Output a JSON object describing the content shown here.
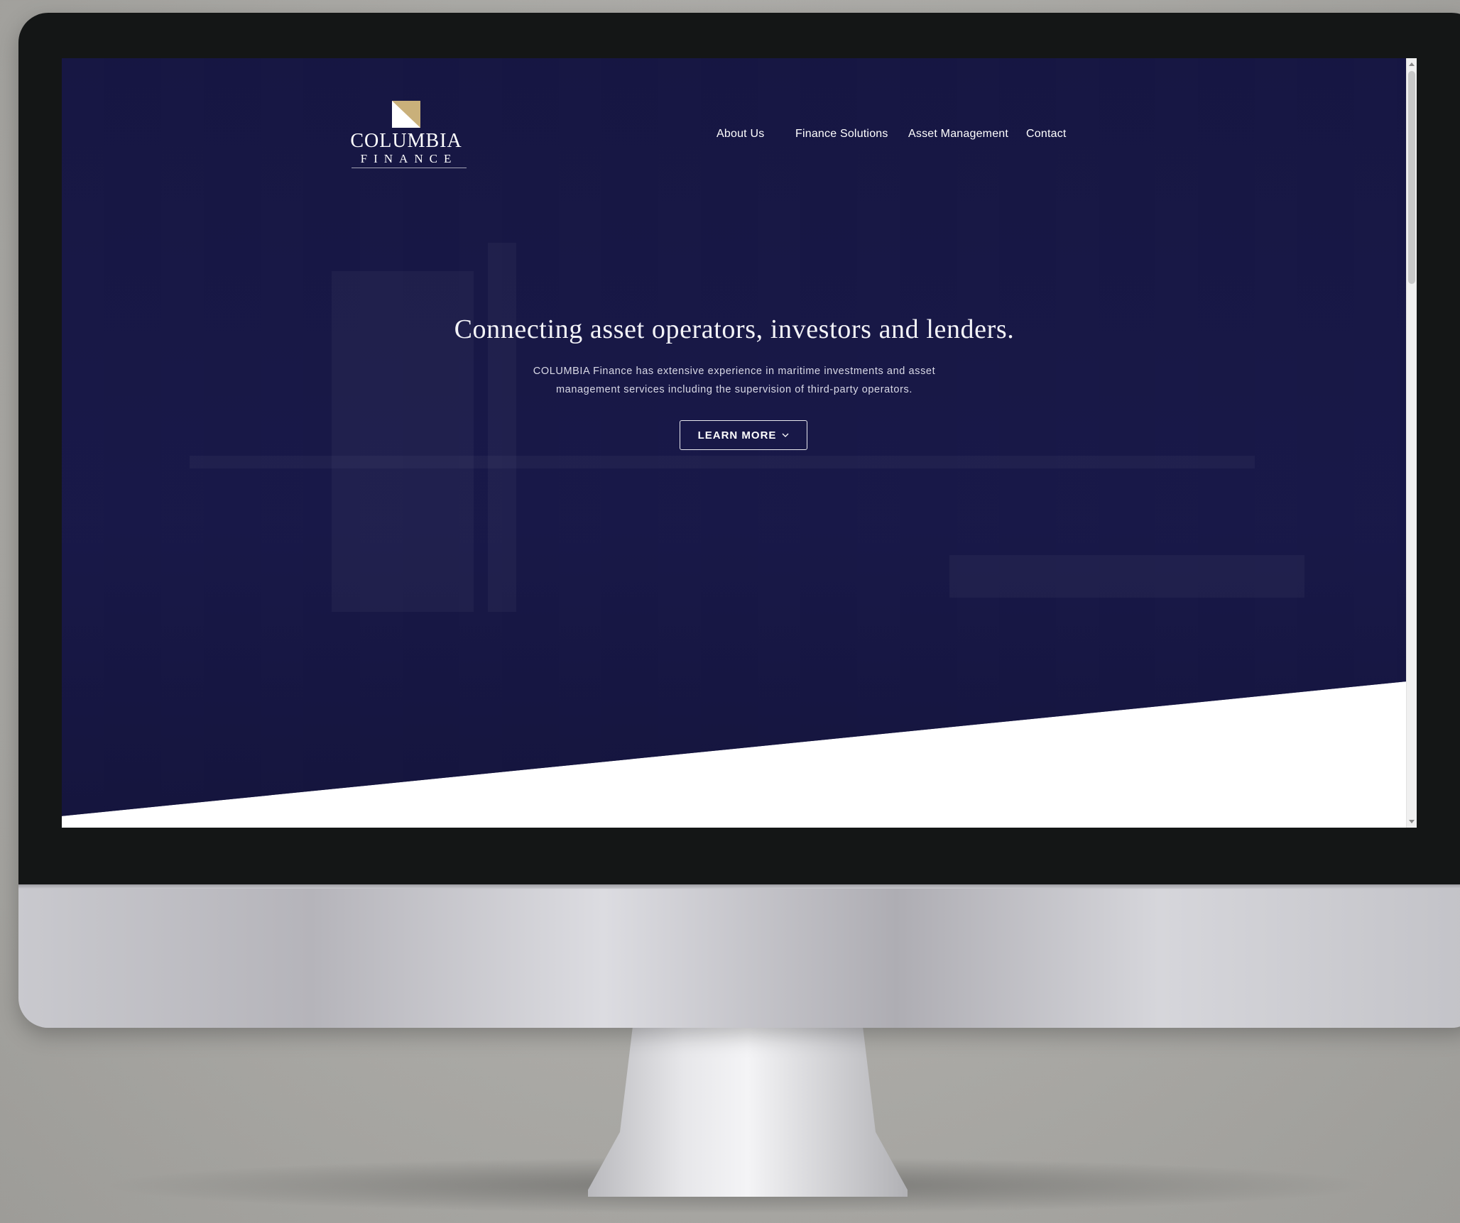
{
  "brand": {
    "name": "COLUMBIA",
    "sub": "FINANCE",
    "mark_colors": {
      "white": "#ffffff",
      "gold": "#c9b07a"
    }
  },
  "nav": {
    "items": [
      {
        "label": "About Us"
      },
      {
        "label": "Finance Solutions"
      },
      {
        "label": "Asset Management"
      },
      {
        "label": "Contact"
      }
    ]
  },
  "hero": {
    "headline": "Connecting asset operators, investors and lenders.",
    "body_line_1": "COLUMBIA Finance has extensive experience in maritime investments and asset",
    "body_line_2": "management services including the supervision of third-party operators.",
    "cta_label": "LEARN MORE",
    "cta_icon": "chevron-down-icon",
    "background_color": "#1b1b4a"
  },
  "colors": {
    "navy": "#1b1b4a",
    "bezel": "#141616",
    "accent_gold": "#c9b07a"
  }
}
